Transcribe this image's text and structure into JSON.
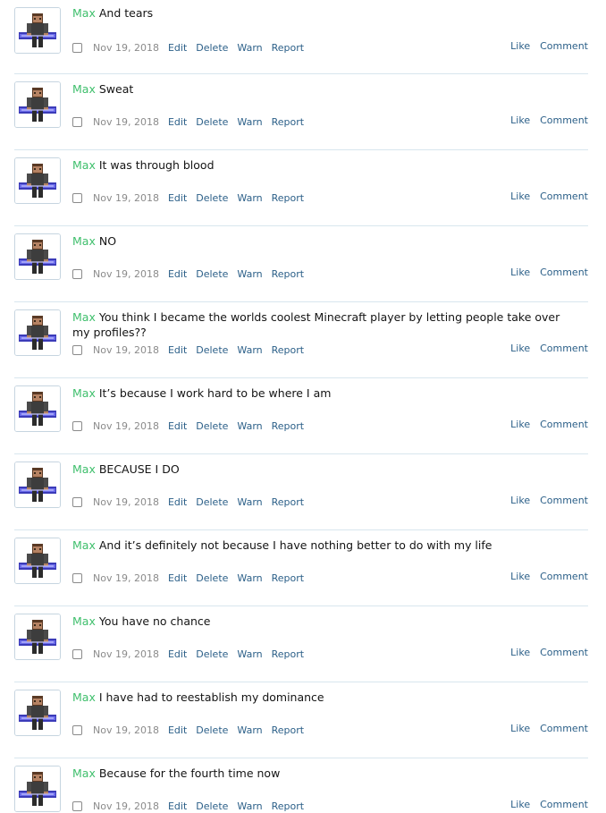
{
  "author": "Max",
  "date": "Nov 19, 2018",
  "actions": {
    "edit": "Edit",
    "delete": "Delete",
    "warn": "Warn",
    "report": "Report",
    "like": "Like",
    "comment": "Comment"
  },
  "posts": [
    {
      "text": "And tears"
    },
    {
      "text": "Sweat"
    },
    {
      "text": "It was through blood"
    },
    {
      "text": "NO"
    },
    {
      "text": "You think I became the worlds coolest Minecraft player by letting people take over my profiles??"
    },
    {
      "text": "It’s because I work hard to be where I am"
    },
    {
      "text": "BECAUSE I DO"
    },
    {
      "text": "And it’s definitely not because I have nothing better to do with my life"
    },
    {
      "text": "You have no chance"
    },
    {
      "text": "I have had to reestablish my dominance"
    },
    {
      "text": "Because for the fourth time now"
    }
  ],
  "colors": {
    "username": "#3fbf6c",
    "link": "#2b5f88",
    "date": "#8b8b8b",
    "divider": "#d8e6ee"
  },
  "avatar_icon": "minecraft-skin-avatar"
}
